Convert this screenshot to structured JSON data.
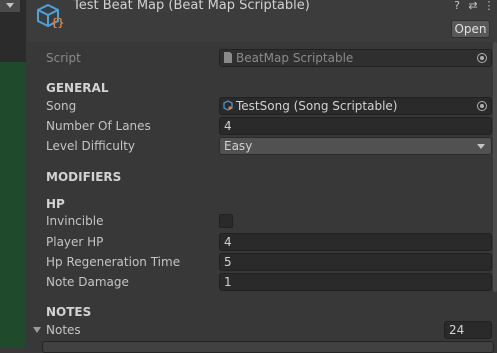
{
  "header": {
    "title": "Test Beat Map (Beat Map Scriptable)",
    "open_label": "Open",
    "icons": [
      "help-icon",
      "presets-icon",
      "more-options-icon"
    ]
  },
  "script_row": {
    "label": "Script",
    "value": "BeatMap Scriptable"
  },
  "general": {
    "heading": "GENERAL",
    "song_label": "Song",
    "song_value": "TestSong (Song Scriptable)",
    "lanes_label": "Number Of Lanes",
    "lanes_value": "4",
    "difficulty_label": "Level Difficulty",
    "difficulty_value": "Easy"
  },
  "modifiers": {
    "heading": "MODIFIERS"
  },
  "hp": {
    "heading": "HP",
    "invincible_label": "Invincible",
    "invincible_checked": false,
    "player_hp_label": "Player HP",
    "player_hp_value": "4",
    "regen_label": "Hp Regeneration Time",
    "regen_value": "5",
    "note_damage_label": "Note Damage",
    "note_damage_value": "1"
  },
  "notes": {
    "heading": "NOTES",
    "list_label": "Notes",
    "count": "24"
  },
  "colors": {
    "background": "#383838",
    "field": "#2a2a2a",
    "scene_green": "#1f4a2b",
    "asset_icon_blue": "#4aa3df",
    "asset_icon_orange": "#e0803a"
  }
}
